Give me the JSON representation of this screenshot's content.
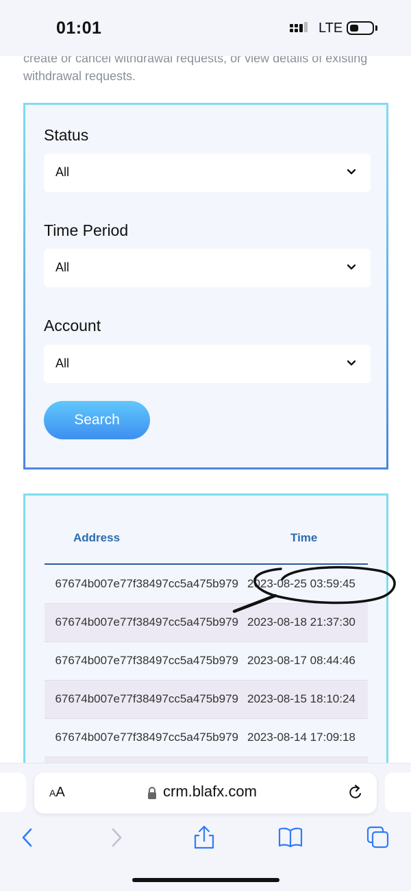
{
  "status_bar": {
    "time": "01:01",
    "network": "LTE"
  },
  "intro_text": "create or cancel withdrawal requests, or view details of existing withdrawal requests.",
  "filters": {
    "status": {
      "label": "Status",
      "value": "All"
    },
    "time_period": {
      "label": "Time Period",
      "value": "All"
    },
    "account": {
      "label": "Account",
      "value": "All"
    },
    "search_label": "Search"
  },
  "table": {
    "headers": {
      "address": "Address",
      "time": "Time"
    },
    "rows": [
      {
        "address": "67674b007e77f38497cc5a475b979",
        "time": "2023-08-25 03:59:45"
      },
      {
        "address": "67674b007e77f38497cc5a475b979",
        "time": "2023-08-18 21:37:30"
      },
      {
        "address": "67674b007e77f38497cc5a475b979",
        "time": "2023-08-17 08:44:46"
      },
      {
        "address": "67674b007e77f38497cc5a475b979",
        "time": "2023-08-15 18:10:24"
      },
      {
        "address": "67674b007e77f38497cc5a475b979",
        "time": "2023-08-14 17:09:18"
      }
    ]
  },
  "browser": {
    "text_size_label": "AA",
    "url": "crm.blafx.com",
    "nav_icons": [
      "back-icon",
      "forward-icon",
      "share-icon",
      "bookmarks-icon",
      "tabs-icon"
    ]
  },
  "colors": {
    "accent": "#2b6cb0",
    "button_gradient_top": "#61c8fb",
    "button_gradient_bottom": "#3d8ff0",
    "card_border": "#7fdcef",
    "card_background": "#f3f6fd"
  }
}
